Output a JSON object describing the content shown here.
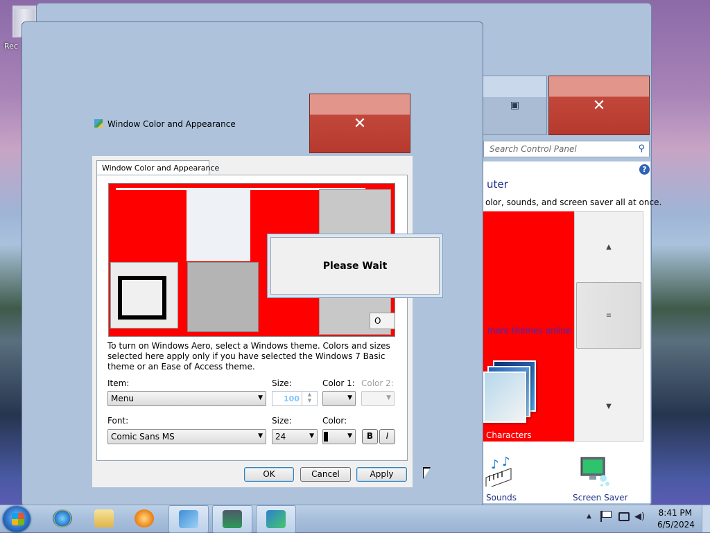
{
  "desktop": {
    "recycle_label": "Rec"
  },
  "control_panel": {
    "search_placeholder": "Search Control Panel",
    "heading": "uter",
    "description": "olor, sounds, and screen saver all at once.",
    "online_link": "more themes online",
    "characters_label": "Characters",
    "sounds_label": "Sounds",
    "screensaver_label": "Screen Saver",
    "help_glyph": "?",
    "scroll_thumb_glyph": "≡"
  },
  "dialog": {
    "title": "Window Color and Appearance",
    "tab_label": "Window Color and Appearance",
    "preview_ok": "O",
    "please_wait": "Please Wait",
    "info_text": "To turn on Windows Aero, select a Windows theme.  Colors and sizes selected here apply only if you have selected the Windows 7 Basic theme or an Ease of Access theme.",
    "item_label": "Item:",
    "item_value": "Menu",
    "size_label": "Size:",
    "size_value": "100",
    "color1_label": "Color 1:",
    "color2_label": "Color 2:",
    "font_label": "Font:",
    "font_value": "Comic Sans MS",
    "font_size_label": "Size:",
    "font_size_value": "24",
    "font_color_label": "Color:",
    "bold_label": "B",
    "italic_label": "I",
    "ok_label": "OK",
    "cancel_label": "Cancel",
    "apply_label": "Apply"
  },
  "taskbar": {
    "items": [
      "start",
      "internet-explorer-icon",
      "explorer-icon",
      "media-player-icon",
      "control-panel-icon",
      "system-icon",
      "display-icon"
    ],
    "clock_time": "8:41 PM",
    "clock_date": "6/5/2024"
  },
  "colors": {
    "preview_red": "#ff0000",
    "close_red": "#c2483b",
    "glass": "#aec3db"
  }
}
